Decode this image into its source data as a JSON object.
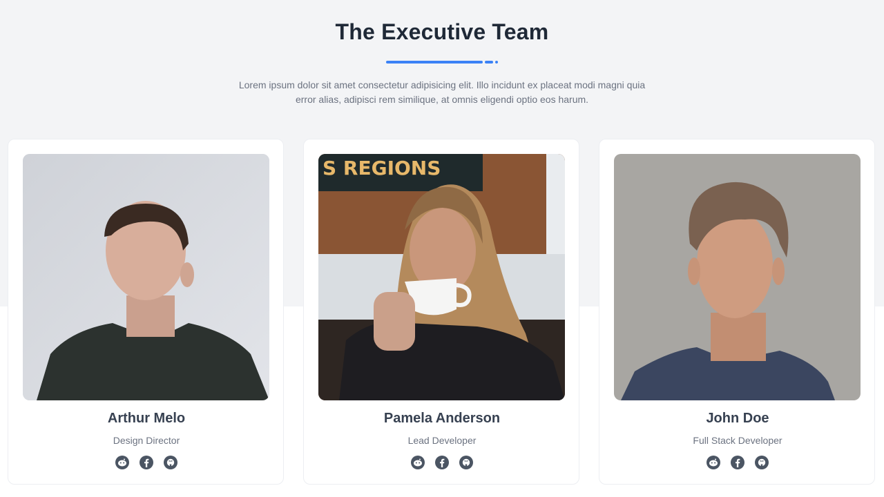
{
  "header": {
    "title": "The Executive Team",
    "intro": "Lorem ipsum dolor sit amet consectetur adipisicing elit. Illo incidunt ex placeat modi magni quia error alias, adipisci rem similique, at omnis eligendi optio eos harum.",
    "accent_color": "#3b82f6"
  },
  "team": [
    {
      "name": "Arthur Melo",
      "role": "Design Director"
    },
    {
      "name": "Pamela Anderson",
      "role": "Lead Developer"
    },
    {
      "name": "John Doe",
      "role": "Full Stack Developer"
    }
  ],
  "photos": {
    "cafe_sign": "S REGIONS"
  },
  "social_icons": [
    "reddit-icon",
    "facebook-icon",
    "github-icon"
  ]
}
